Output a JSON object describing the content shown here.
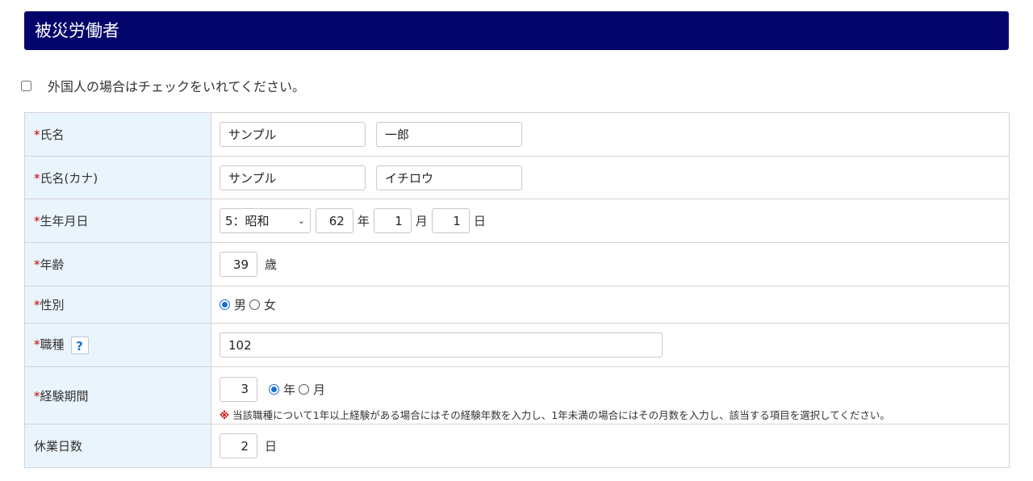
{
  "header": {
    "title": "被災労働者"
  },
  "foreign": {
    "label": "外国人の場合はチェックをいれてください。",
    "checked": false
  },
  "rows": {
    "name": {
      "required": "*",
      "label": "氏名",
      "last": "サンプル",
      "first": "一郎"
    },
    "kana": {
      "required": "*",
      "label": "氏名(カナ)",
      "last": "サンプル",
      "first": "イチロウ"
    },
    "birth": {
      "required": "*",
      "label": "生年月日",
      "era": "5：昭和",
      "year": "62",
      "year_unit": "年",
      "month": "1",
      "month_unit": "月",
      "day": "1",
      "day_unit": "日"
    },
    "age": {
      "required": "*",
      "label": "年齢",
      "value": "39",
      "unit": "歳"
    },
    "gender": {
      "required": "*",
      "label": "性別",
      "male": "男",
      "female": "女",
      "selected": "男"
    },
    "job": {
      "required": "*",
      "label": "職種",
      "help": "?",
      "value": "102"
    },
    "experience": {
      "required": "*",
      "label": "経験期間",
      "value": "3",
      "opt_year": "年",
      "opt_month": "月",
      "selected": "年",
      "note_mark": "※",
      "note": "当該職種について1年以上経験がある場合にはその経験年数を入力し、1年未満の場合にはその月数を入力し、該当する項目を選択してください。"
    },
    "leave": {
      "label": "休業日数",
      "value": "2",
      "unit": "日"
    }
  }
}
